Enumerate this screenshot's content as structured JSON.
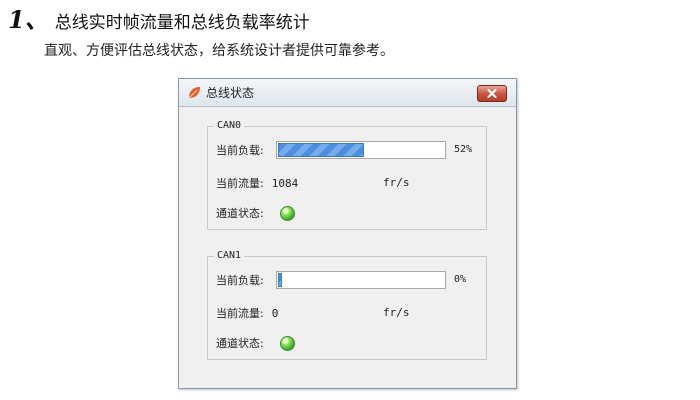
{
  "heading": {
    "number": "1、",
    "text": "总线实时帧流量和总线负载率统计"
  },
  "subheading": "直观、方便评估总线状态，给系统设计者提供可靠参考。",
  "window": {
    "title": "总线状态",
    "app_icon": "leaf-icon",
    "close_icon": "close-icon"
  },
  "channels": [
    {
      "name": "CAN0",
      "load_label": "当前负载:",
      "load_percent": 52,
      "load_text": "52%",
      "flow_label": "当前流量:",
      "flow_value": "1084",
      "flow_unit": "fr/s",
      "status_label": "通道状态:",
      "status_color": "#5cc33a"
    },
    {
      "name": "CAN1",
      "load_label": "当前负载:",
      "load_percent": 0,
      "load_text": "0%",
      "flow_label": "当前流量:",
      "flow_value": "0",
      "flow_unit": "fr/s",
      "status_label": "通道状态:",
      "status_color": "#5cc33a"
    }
  ]
}
